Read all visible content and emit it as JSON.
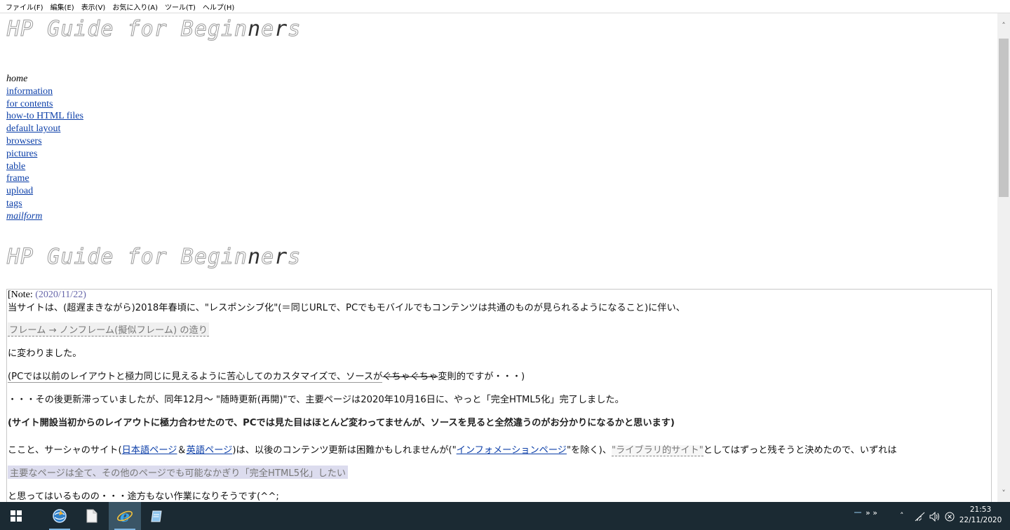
{
  "menu": [
    "ファイル(F)",
    "編集(E)",
    "表示(V)",
    "お気に入り(A)",
    "ツール(T)",
    "ヘルプ(H)"
  ],
  "logo": {
    "main": "HP Guide for Begin",
    "dark": "n",
    "mid": "e",
    "dark2": "r",
    "end": "s"
  },
  "nav": {
    "home": "home",
    "links": [
      "information",
      "for contents",
      "how-to HTML files",
      "default layout",
      "browsers",
      "pictures",
      "table",
      "frame",
      "upload",
      "tags"
    ],
    "mailform": "mailform"
  },
  "note": {
    "label": "[Note:",
    "date": "(2020/11/22)",
    "p1": "当サイトは、(超遅まきながら)2018年春頃に、\"レスポンシブ化\"(＝同じURLで、PCでもモバイルでもコンテンツは共通のものが見られるようになること)に伴い、",
    "p2": "フレーム → ノンフレーム(擬似フレーム) の造り",
    "p3": "に変わりました。",
    "p4a": "(PCでは以前のレイアウトと極力同じに見えるように苦心してのカスタマイズで、ソースが",
    "p4strike": "ぐちゃぐちゃ",
    "p4b": "変則的ですが・・・)",
    "p5a": "・・・その後更新滞っていましたが、同年12月～ \"随時更新(再開)\"で、主要ページは2020年10月16日に、やっと「完全HTML5化」完了しました。",
    "p6": "(サイト開設当初からのレイアウトに極力合わせたので、PCでは見た目はほとんど変わってませんが、ソースを見ると全然違うのがお分かりになるかと思います)",
    "p7a": "ここと、サーシャのサイト(",
    "p7link1": "日本語ページ",
    "p7amp": "＆",
    "p7link2": "英語ページ",
    "p7b": ")は、以後のコンテンツ更新は困難かもしれませんが(\"",
    "p7link3": "インフォメーションページ",
    "p7c": "\"を除く)、",
    "p7dashed": "\"ライブラリ的サイト\"",
    "p7d": "としてはずっと残そうと決めたので、いずれは",
    "p8": "主要なページは全て、その他のページでも可能なかぎり「完全HTML5化」したい",
    "p9": "と思ってはいるものの・・・途方もない作業になりそうです(^^;"
  },
  "taskbar": {
    "clock_time": "21:53",
    "clock_date": "22/11/2020",
    "tray_chevrons": "» »"
  }
}
